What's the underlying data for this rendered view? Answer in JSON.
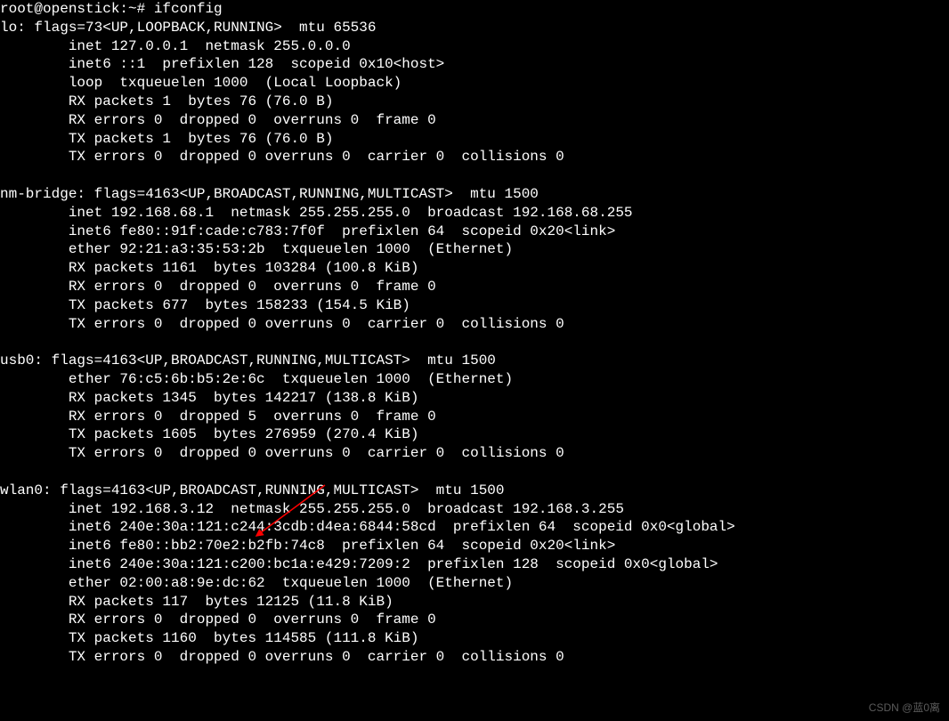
{
  "prompt": "root@openstick:~# ",
  "command": "ifconfig",
  "interfaces": [
    {
      "name": "lo",
      "header": "lo: flags=73<UP,LOOPBACK,RUNNING>  mtu 65536",
      "lines": [
        "        inet 127.0.0.1  netmask 255.0.0.0",
        "        inet6 ::1  prefixlen 128  scopeid 0x10<host>",
        "        loop  txqueuelen 1000  (Local Loopback)",
        "        RX packets 1  bytes 76 (76.0 B)",
        "        RX errors 0  dropped 0  overruns 0  frame 0",
        "        TX packets 1  bytes 76 (76.0 B)",
        "        TX errors 0  dropped 0 overruns 0  carrier 0  collisions 0"
      ]
    },
    {
      "name": "nm-bridge",
      "header": "nm-bridge: flags=4163<UP,BROADCAST,RUNNING,MULTICAST>  mtu 1500",
      "lines": [
        "        inet 192.168.68.1  netmask 255.255.255.0  broadcast 192.168.68.255",
        "        inet6 fe80::91f:cade:c783:7f0f  prefixlen 64  scopeid 0x20<link>",
        "        ether 92:21:a3:35:53:2b  txqueuelen 1000  (Ethernet)",
        "        RX packets 1161  bytes 103284 (100.8 KiB)",
        "        RX errors 0  dropped 0  overruns 0  frame 0",
        "        TX packets 677  bytes 158233 (154.5 KiB)",
        "        TX errors 0  dropped 0 overruns 0  carrier 0  collisions 0"
      ]
    },
    {
      "name": "usb0",
      "header": "usb0: flags=4163<UP,BROADCAST,RUNNING,MULTICAST>  mtu 1500",
      "lines": [
        "        ether 76:c5:6b:b5:2e:6c  txqueuelen 1000  (Ethernet)",
        "        RX packets 1345  bytes 142217 (138.8 KiB)",
        "        RX errors 0  dropped 5  overruns 0  frame 0",
        "        TX packets 1605  bytes 276959 (270.4 KiB)",
        "        TX errors 0  dropped 0 overruns 0  carrier 0  collisions 0"
      ]
    },
    {
      "name": "wlan0",
      "header": "wlan0: flags=4163<UP,BROADCAST,RUNNING,MULTICAST>  mtu 1500",
      "lines": [
        "        inet 192.168.3.12  netmask 255.255.255.0  broadcast 192.168.3.255",
        "        inet6 240e:30a:121:c244:3cdb:d4ea:6844:58cd  prefixlen 64  scopeid 0x0<global>",
        "        inet6 fe80::bb2:70e2:b2fb:74c8  prefixlen 64  scopeid 0x20<link>",
        "        inet6 240e:30a:121:c200:bc1a:e429:7209:2  prefixlen 128  scopeid 0x0<global>",
        "        ether 02:00:a8:9e:dc:62  txqueuelen 1000  (Ethernet)",
        "        RX packets 117  bytes 12125 (11.8 KiB)",
        "        RX errors 0  dropped 0  overruns 0  frame 0",
        "        TX packets 1160  bytes 114585 (111.8 KiB)",
        "        TX errors 0  dropped 0 overruns 0  carrier 0  collisions 0"
      ]
    }
  ],
  "watermark": "CSDN @蓝0离",
  "arrow_color": "#ff0000"
}
